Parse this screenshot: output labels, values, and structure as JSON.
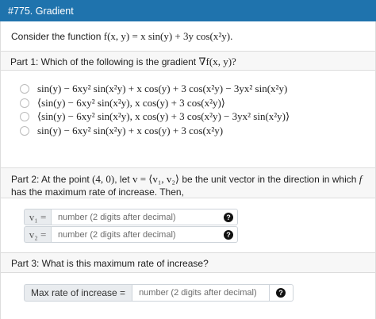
{
  "header": {
    "title": "#775. Gradient"
  },
  "intro": {
    "prefix": "Consider the function ",
    "function": "f(x, y) = x sin(y) + 3y cos(x²y)."
  },
  "part1": {
    "label": "Part 1: Which of the following is the gradient ",
    "gradient": "∇f(x, y)?",
    "options": [
      "sin(y) − 6xy² sin(x²y) + x cos(y) + 3 cos(x²y) − 3yx² sin(x²y)",
      "⟨sin(y) − 6xy² sin(x²y), x cos(y) + 3 cos(x²y)⟩",
      "⟨sin(y) − 6xy² sin(x²y), x cos(y) + 3 cos(x²y) − 3yx² sin(x²y)⟩",
      "sin(y) − 6xy² sin(x²y) + x cos(y) + 3 cos(x²y)"
    ]
  },
  "part2": {
    "t1": "Part 2: At the point ",
    "point": "(4, 0)",
    "t2": ", let ",
    "vec": "v = ⟨v₁, v₂⟩",
    "t3": " be the unit vector in the direction in which ",
    "f": "f",
    "t4": " has the maximum rate of increase. Then,",
    "inputs": [
      {
        "label": "v₁ =",
        "placeholder": "number (2 digits after decimal)",
        "value": ""
      },
      {
        "label": "v₂ =",
        "placeholder": "number (2 digits after decimal)",
        "value": ""
      }
    ]
  },
  "part3": {
    "label": "Part 3: What is this maximum rate of increase?",
    "input_label": "Max rate of increase =",
    "placeholder": "number (2 digits after decimal)",
    "value": ""
  },
  "help_glyph": "?",
  "icons": {
    "help": "question-circle-icon",
    "radio": "radio-circle"
  },
  "colors": {
    "header_bg": "#1f73ad",
    "section_bg": "#f7f7f7",
    "help_icon": "#111111"
  }
}
